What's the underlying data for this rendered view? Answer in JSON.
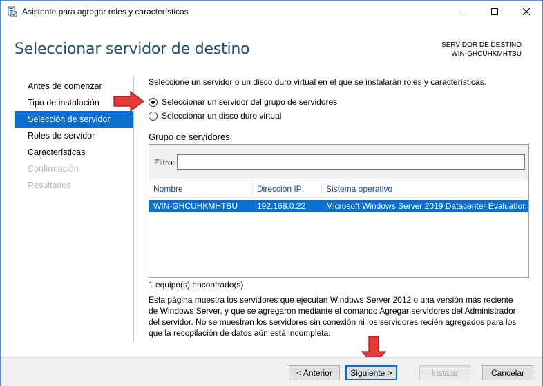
{
  "window": {
    "title": "Asistente para agregar roles y características",
    "icon": "server-wizard-icon"
  },
  "header": {
    "title": "Seleccionar servidor de destino",
    "dest_label": "SERVIDOR DE DESTINO",
    "dest_server": "WIN-GHCUHKMHTBU"
  },
  "nav": {
    "items": [
      {
        "label": "Antes de comenzar",
        "state": "normal"
      },
      {
        "label": "Tipo de instalación",
        "state": "normal"
      },
      {
        "label": "Selección de servidor",
        "state": "active"
      },
      {
        "label": "Roles de servidor",
        "state": "normal"
      },
      {
        "label": "Características",
        "state": "normal"
      },
      {
        "label": "Confirmación",
        "state": "disabled"
      },
      {
        "label": "Resultados",
        "state": "disabled"
      }
    ]
  },
  "content": {
    "intro": "Seleccione un servidor o un disco duro virtual en el que se instalarán roles y características.",
    "option_pool": "Seleccionar un servidor del grupo de servidores",
    "option_vhd": "Seleccionar un disco duro virtual",
    "selected_option": "pool",
    "group_title": "Grupo de servidores",
    "filter_label": "Filtro:",
    "filter_value": "",
    "columns": [
      "Nombre",
      "Dirección IP",
      "Sistema operativo"
    ],
    "rows": [
      {
        "name": "WIN-GHCUHKMHTBU",
        "ip": "192.168.0.22",
        "os": "Microsoft Windows Server 2019 Datacenter Evaluation",
        "selected": true
      }
    ],
    "count": "1 equipo(s) encontrado(s)",
    "description": "Esta página muestra los servidores que ejecutan Windows Server 2012 o una versión más reciente de Windows Server, y que se agregaron mediante el comando Agregar servidores del Administrador del servidor. No se muestran los servidores sin conexión ni los servidores recién agregados para los que la recopilación de datos aún está incompleta."
  },
  "buttons": {
    "previous": "< Anterior",
    "next": "Siguiente >",
    "install": "Instalar",
    "cancel": "Cancelar"
  },
  "colors": {
    "accent": "#0a6fce",
    "title": "#1e4e79",
    "annotation_arrow": "#e8393a"
  }
}
